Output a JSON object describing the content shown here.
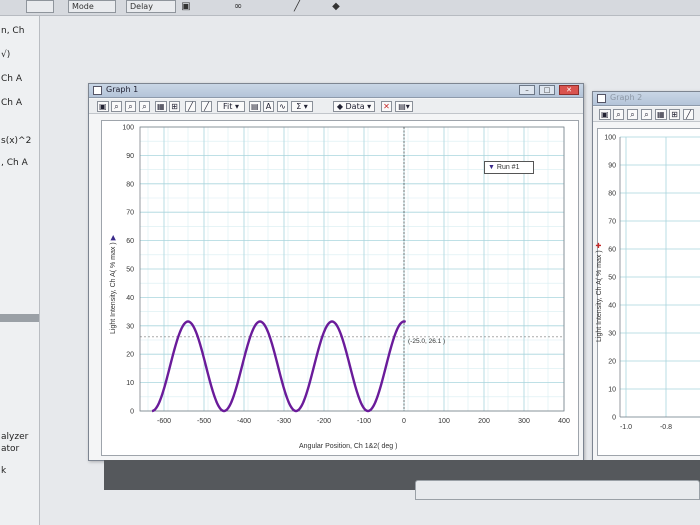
{
  "toolbar_top": {
    "mode_label": "Mode",
    "delay_label": "Delay",
    "buttons": [
      "save-icon",
      "link-icon",
      "pen-icon",
      "eraser-icon"
    ]
  },
  "left_panel": {
    "items": [
      "n, Ch",
      "√)",
      "Ch A",
      "Ch A",
      "s(x)^2",
      ", Ch A",
      "alyzer",
      "ator",
      "k"
    ]
  },
  "graph1": {
    "title": "Graph 1",
    "tools": {
      "fit_label": "Fit",
      "data_label": "Data",
      "text_tool": "A",
      "sigma": "Σ"
    },
    "ylabel": "Light Intensity, Ch A( % max )",
    "xlabel": "Angular Position, Ch 1&2( deg )",
    "legend": {
      "marker": "▼",
      "label": "Run #1"
    },
    "coord_readout": "(-25.0, 26.1 )"
  },
  "graph2": {
    "title": "Graph 2",
    "ylabel": "Light Intensity, Ch A( % max )",
    "yticks": [
      "100",
      "90",
      "80",
      "70",
      "60",
      "50",
      "40",
      "30",
      "20",
      "10",
      "0"
    ],
    "xticks": [
      "-1.0",
      "-0.8",
      "-0"
    ]
  },
  "chart_data": {
    "type": "line",
    "title": "Graph 1",
    "xlabel": "Angular Position, Ch 1&2( deg )",
    "ylabel": "Light Intensity, Ch A( % max )",
    "xlim": [
      -660,
      400
    ],
    "ylim": [
      0,
      100
    ],
    "xticks": [
      -600,
      -500,
      -400,
      -300,
      -200,
      -100,
      0,
      100,
      200,
      300,
      400
    ],
    "yticks": [
      0,
      10,
      20,
      30,
      40,
      50,
      60,
      70,
      80,
      90,
      100
    ],
    "grid": true,
    "legend_position": "top-right",
    "series": [
      {
        "name": "Run #1",
        "color": "#6a1b9a",
        "period": 180,
        "x_start": -630,
        "x_end": 5,
        "min_at": -630,
        "y_min": 0,
        "y_max": 31.5
      }
    ],
    "annotations": [
      {
        "text": "(-25.0, 26.1 )",
        "x": -25.0,
        "y": 26.1
      }
    ],
    "cursor_x": 0
  }
}
